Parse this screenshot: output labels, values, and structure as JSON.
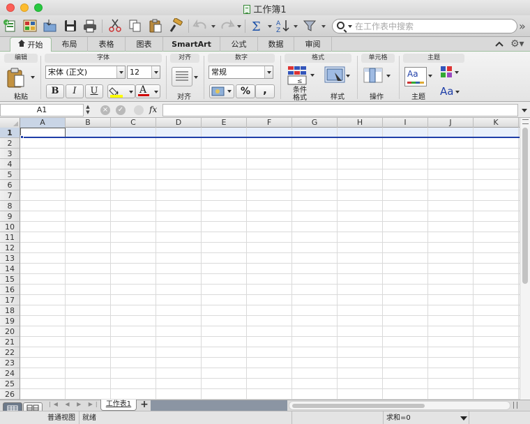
{
  "window": {
    "title": "工作簿1"
  },
  "search": {
    "placeholder": "在工作表中搜索"
  },
  "ribbon_tabs": [
    {
      "label": "开始"
    },
    {
      "label": "布局"
    },
    {
      "label": "表格"
    },
    {
      "label": "图表"
    },
    {
      "label": "SmartArt"
    },
    {
      "label": "公式"
    },
    {
      "label": "数据"
    },
    {
      "label": "审阅"
    }
  ],
  "groups": {
    "edit": {
      "title": "编辑",
      "paste_label": "粘贴"
    },
    "font": {
      "title": "字体",
      "font_name": "宋体 (正文)",
      "font_size": "12",
      "bold": "B",
      "italic": "I",
      "underline": "U",
      "font_color_glyph": "A"
    },
    "align": {
      "title": "对齐",
      "align_label": "对齐"
    },
    "number": {
      "title": "数字",
      "format": "常规",
      "percent": "%",
      "comma": ","
    },
    "format": {
      "title": "格式",
      "conditional_l1": "条件",
      "conditional_l2": "格式",
      "style_label": "样式"
    },
    "cells": {
      "title": "单元格",
      "actions_label": "操作"
    },
    "themes": {
      "title": "主题",
      "theme_label": "主题",
      "theme_preview": "Aa",
      "fonts_glyph": "Aa"
    }
  },
  "formula_bar": {
    "name_box": "A1",
    "fx": "fx",
    "cancel": "×",
    "confirm": "✓",
    "value": ""
  },
  "columns": [
    "A",
    "B",
    "C",
    "D",
    "E",
    "F",
    "G",
    "H",
    "I",
    "J",
    "K"
  ],
  "rows": [
    "1",
    "2",
    "3",
    "4",
    "5",
    "6",
    "7",
    "8",
    "9",
    "10",
    "11",
    "12",
    "13",
    "14",
    "15",
    "16",
    "17",
    "18",
    "19",
    "20",
    "21",
    "22",
    "23",
    "24",
    "25",
    "26"
  ],
  "sheets": [
    {
      "label": "工作表1"
    }
  ],
  "sheet_add": "+",
  "status": {
    "view": "普通视图",
    "ready": "就绪",
    "sum": "求和=0"
  },
  "colors": {
    "accent_green": "#9fbf9f",
    "selection_blue": "#1e3ea8",
    "font_color_red": "#d00000",
    "highlight_yellow": "#ffff00"
  },
  "toolbar_icons": [
    "new-icon",
    "templates-icon",
    "open-icon",
    "save-icon",
    "print-icon",
    "cut-icon",
    "copy-icon",
    "paste-icon",
    "format-painter-icon",
    "undo-icon",
    "redo-icon",
    "autosum-icon",
    "sort-icon",
    "filter-icon"
  ]
}
